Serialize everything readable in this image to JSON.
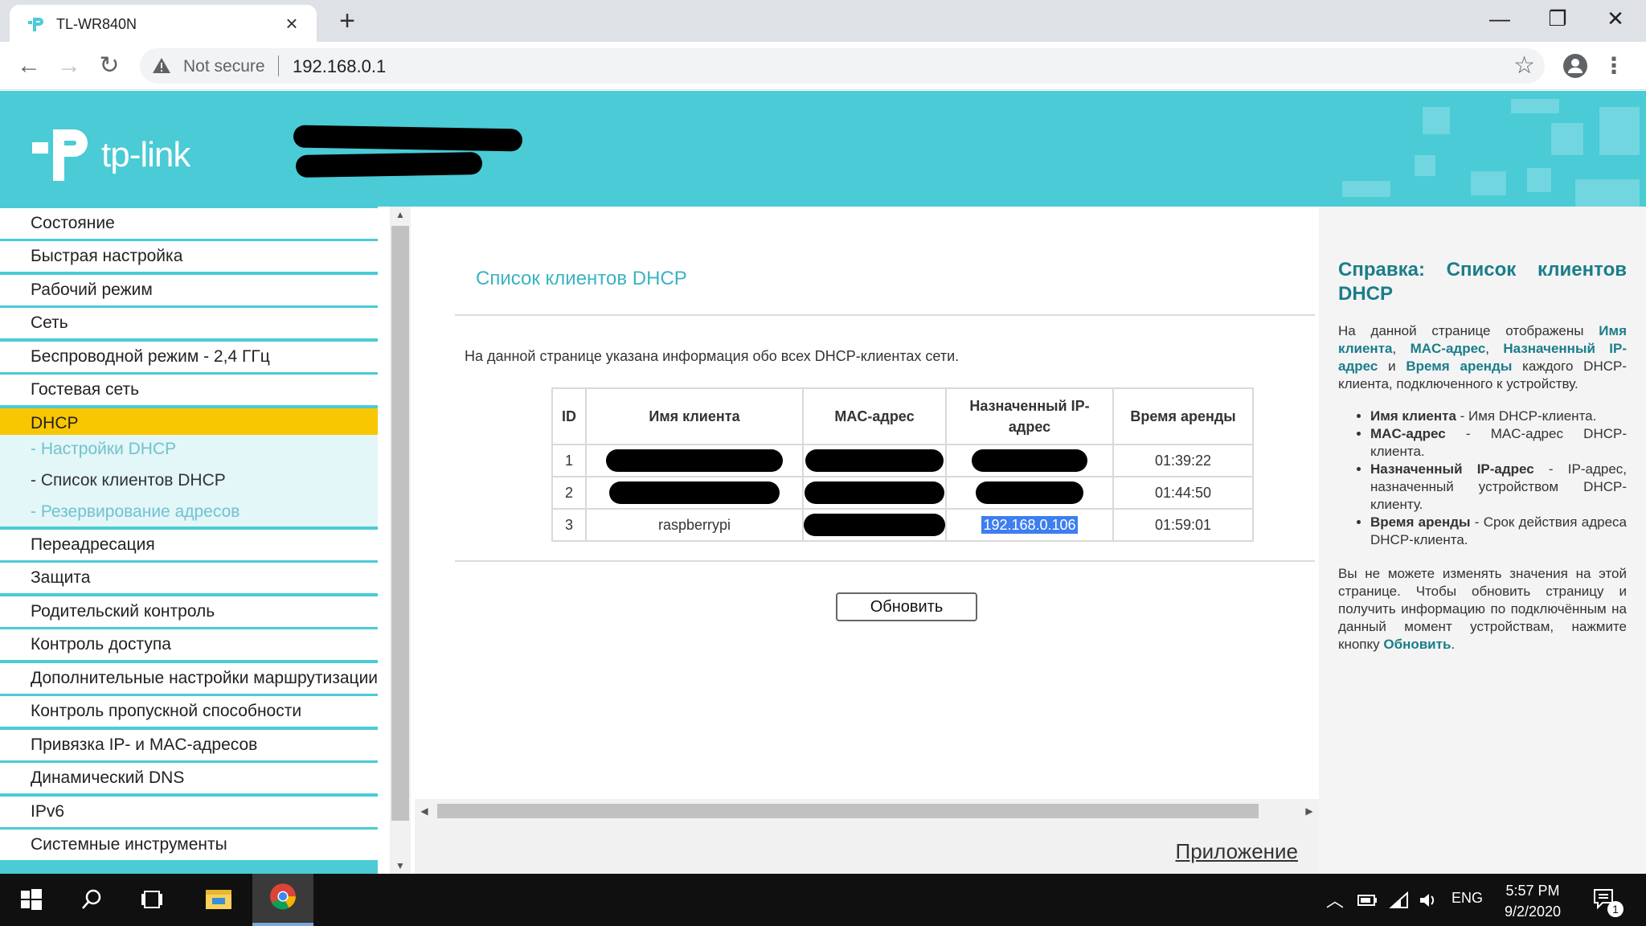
{
  "browser": {
    "tab_title": "TL-WR840N",
    "tab_close": "×",
    "new_tab": "+",
    "not_secure": "Not secure",
    "url": "192.168.0.1",
    "star": "☆",
    "menu": "⋮",
    "back": "←",
    "forward": "→",
    "reload": "↻",
    "minimize": "—",
    "restore": "❐",
    "close": "✕"
  },
  "brand": {
    "logo_text": "tp-link",
    "accent": "#4acbd6",
    "active": "#f9c701"
  },
  "menu": {
    "items": [
      "Состояние",
      "Быстрая настройка",
      "Рабочий режим",
      "Сеть",
      "Беспроводной режим - 2,4 ГГц",
      "Гостевая сеть",
      "DHCP",
      "Переадресация",
      "Защита",
      "Родительский контроль",
      "Контроль доступа",
      "Дополнительные настройки маршрутизации",
      "Контроль пропускной способности",
      "Привязка IP- и MAC-адресов",
      "Динамический DNS",
      "IPv6",
      "Системные инструменты"
    ],
    "sub_items": [
      "- Настройки DHCP",
      "- Список клиентов DHCP",
      "- Резервирование адресов"
    ]
  },
  "content": {
    "title": "Список клиентов DHCP",
    "description": "На данной странице указана информация обо всех DHCP-клиентах сети.",
    "table": {
      "headers": [
        "ID",
        "Имя клиента",
        "MAC-адрес",
        "Назначенный IP-адрес",
        "Время аренды"
      ],
      "rows": [
        {
          "id": "1",
          "name": "",
          "mac": "",
          "ip": "",
          "lease": "01:39:22"
        },
        {
          "id": "2",
          "name": "",
          "mac": "",
          "ip": "",
          "lease": "01:44:50"
        },
        {
          "id": "3",
          "name": "raspberrypi",
          "mac": "",
          "ip": "192.168.0.106",
          "lease": "01:59:01"
        }
      ]
    },
    "refresh_button": "Обновить",
    "app_link": "Приложение"
  },
  "help": {
    "title": "Справка: Список клиентов DHCP",
    "intro_1": "На данной странице отображены ",
    "intro_kw1": "Имя клиента",
    "intro_2": ", ",
    "intro_kw2": "MAC-адрес",
    "intro_3": ", ",
    "intro_kw3": "Назначенный IP-адрес",
    "intro_4": " и ",
    "intro_kw4": "Время аренды",
    "intro_5": " каждого DHCP-клиента, подключенного к устройству.",
    "bullets": [
      {
        "term": "Имя клиента",
        "text": " - Имя DHCP-клиента."
      },
      {
        "term": "MAC-адрес",
        "text": " - MAC-адрес DHCP-клиента."
      },
      {
        "term": "Назначенный IP-адрес",
        "text": " - IP-адрес, назначенный устройством DHCP-клиенту."
      },
      {
        "term": "Время аренды",
        "text": " - Срок действия адреса DHCP-клиента."
      }
    ],
    "outro": "Вы не можете изменять значения на этой странице. Чтобы обновить страницу и получить информацию по подключённым на данный момент устройствам, нажмите кнопку ",
    "outro_kw": "Обновить",
    "outro_end": "."
  },
  "taskbar": {
    "lang": "ENG",
    "time": "5:57 PM",
    "date": "9/2/2020",
    "notification_count": "1"
  }
}
